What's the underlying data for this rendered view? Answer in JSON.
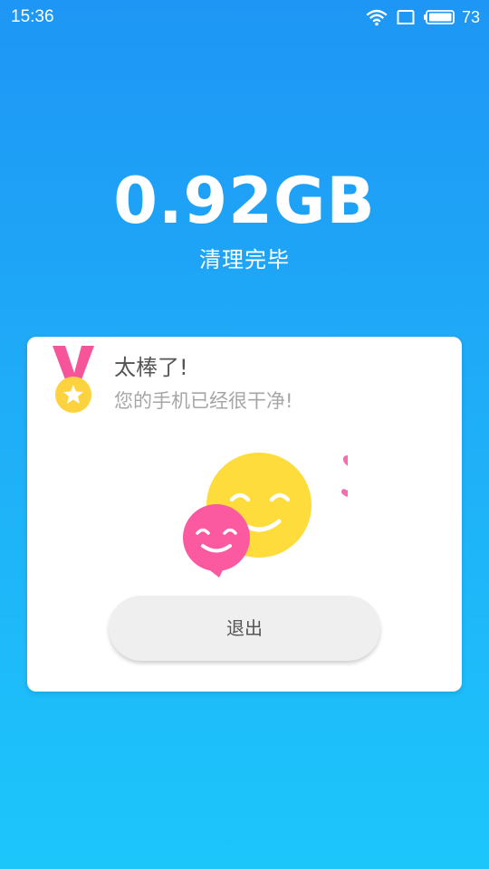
{
  "status_bar": {
    "time": "15:36",
    "battery_level": "73",
    "icons": [
      "wifi-icon",
      "screen-icon",
      "battery-icon"
    ]
  },
  "result": {
    "cleaned_size": "0.92GB",
    "status": "清理完毕"
  },
  "card": {
    "title": "太棒了!",
    "subtitle": "您的手机已经很干净!",
    "exit_label": "退出",
    "icons": [
      "medal-icon",
      "smiley-faces-illustration",
      "hearts-icon"
    ]
  },
  "colors": {
    "background_top": "#1e96f5",
    "background_bottom": "#1cc6fb",
    "card": "#ffffff",
    "smiley_yellow": "#fddc3c",
    "smiley_pink": "#fb5aa1",
    "medal_ribbon": "#f6559a",
    "medal_gold": "#fdd23f"
  }
}
